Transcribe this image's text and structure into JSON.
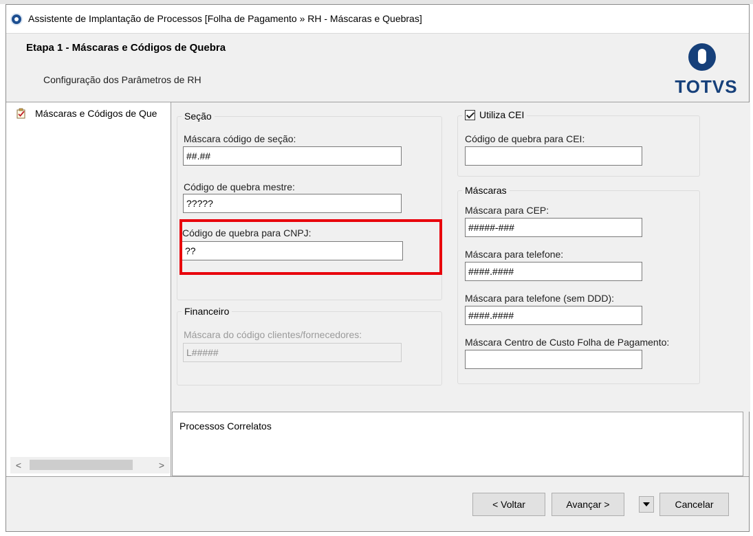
{
  "window": {
    "title": "Assistente de Implantação de Processos [Folha de Pagamento » RH - Máscaras e Quebras]"
  },
  "header": {
    "step_title": "Etapa 1 - Máscaras e Códigos de Quebra",
    "subtitle": "Configuração dos Parâmetros de RH",
    "logo_text": "TOTVS"
  },
  "sidebar": {
    "items": [
      {
        "label": "Máscaras e Códigos de Que",
        "icon": "checklist-icon"
      }
    ],
    "scroll_left": "<",
    "scroll_right": ">"
  },
  "secao": {
    "legend": "Seção",
    "mascara_secao_label": "Máscara código de seção:",
    "mascara_secao_value": "##.##",
    "quebra_mestre_label": "Código de quebra mestre:",
    "quebra_mestre_value": "?????",
    "quebra_cnpj_label": "Código de quebra para CNPJ:",
    "quebra_cnpj_value": "??"
  },
  "financeiro": {
    "legend": "Financeiro",
    "mascara_clientes_label": "Máscara do código clientes/fornecedores:",
    "mascara_clientes_value": "L#####"
  },
  "cei": {
    "legend": "Utiliza CEI",
    "checked": true,
    "quebra_cei_label": "Código de quebra para CEI:",
    "quebra_cei_value": ""
  },
  "mascaras": {
    "legend": "Máscaras",
    "cep_label": "Máscara para CEP:",
    "cep_value": "#####-###",
    "telefone_label": "Máscara para telefone:",
    "telefone_value": "####.####",
    "telefone_sem_ddd_label": "Máscara para telefone (sem DDD):",
    "telefone_sem_ddd_value": "####.####",
    "centro_custo_label": "Máscara Centro de Custo Folha de Pagamento:",
    "centro_custo_value": ""
  },
  "related": {
    "label": "Processos Correlatos"
  },
  "footer": {
    "back_label": "< Voltar",
    "next_label": "Avançar >",
    "cancel_label": "Cancelar"
  },
  "colors": {
    "highlight": "#e8000b",
    "brand": "#16407a"
  }
}
